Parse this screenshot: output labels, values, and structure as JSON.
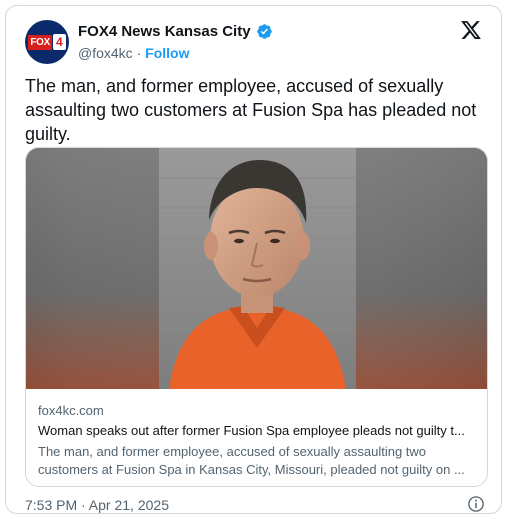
{
  "account": {
    "display_name": "FOX4 News Kansas City",
    "handle": "@fox4kc",
    "separator": "·",
    "follow_label": "Follow",
    "logo_word": "FOX",
    "logo_number": "4"
  },
  "tweet": {
    "text": "The man, and former employee, accused of sexually assaulting two customers at Fusion Spa has pleaded not guilty."
  },
  "link_card": {
    "domain": "fox4kc.com",
    "title": "Woman speaks out after former Fusion Spa employee pleads not guilty t...",
    "description": "The man, and former employee, accused of sexually assaulting two customers at Fusion Spa in Kansas City, Missouri, pleaded not guilty on ..."
  },
  "footer": {
    "timestamp": "7:53 PM · Apr 21, 2025"
  },
  "colors": {
    "verified_blue": "#1d9bf0",
    "text_primary": "#0f1419",
    "text_secondary": "#536471",
    "border": "#cfd9de",
    "brand_red": "#d81e1e",
    "brand_navy": "#0b2a6b",
    "jumpsuit_orange": "#e8622a"
  },
  "icons": [
    "verified-badge-icon",
    "x-logo-icon",
    "info-icon"
  ]
}
